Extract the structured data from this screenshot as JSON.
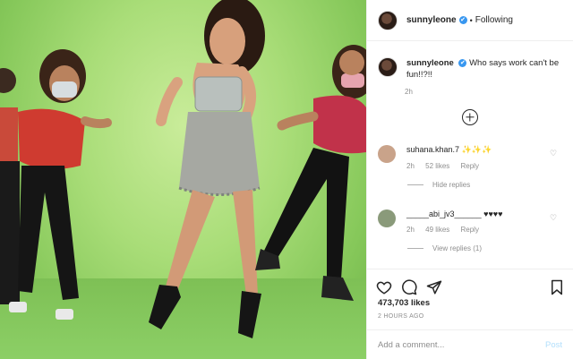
{
  "header": {
    "username": "sunnyleone",
    "verified_mark": "✔",
    "separator": "•",
    "follow_status": "Following"
  },
  "caption": {
    "username": "sunnyleone",
    "text": "Who says work can't be fun!!?!!",
    "time": "2h"
  },
  "load_more_icon": "plus-circle-icon",
  "comments": [
    {
      "username": "suhana.khan.7",
      "text": "✨✨✨",
      "time": "2h",
      "likes": "52 likes",
      "reply": "Reply",
      "replies_toggle": "Hide replies",
      "avatar_color": "#c9a38a"
    },
    {
      "username": "_____abi_jv3______",
      "text": "♥♥♥♥",
      "time": "2h",
      "likes": "49 likes",
      "reply": "Reply",
      "replies_toggle": "View replies (1)",
      "avatar_color": "#8a9a7a"
    }
  ],
  "actions": {
    "likes_count": "473,703 likes",
    "posted_ago": "2 HOURS AGO",
    "icons": [
      "heart-icon",
      "comment-icon",
      "share-icon",
      "bookmark-icon"
    ]
  },
  "add_comment": {
    "placeholder": "Add a comment...",
    "post_label": "Post"
  },
  "colors": {
    "background": "#ffffff",
    "link_blue": "#3897f0",
    "post_disabled": "#b2dffc",
    "muted": "#8e8e8e"
  }
}
